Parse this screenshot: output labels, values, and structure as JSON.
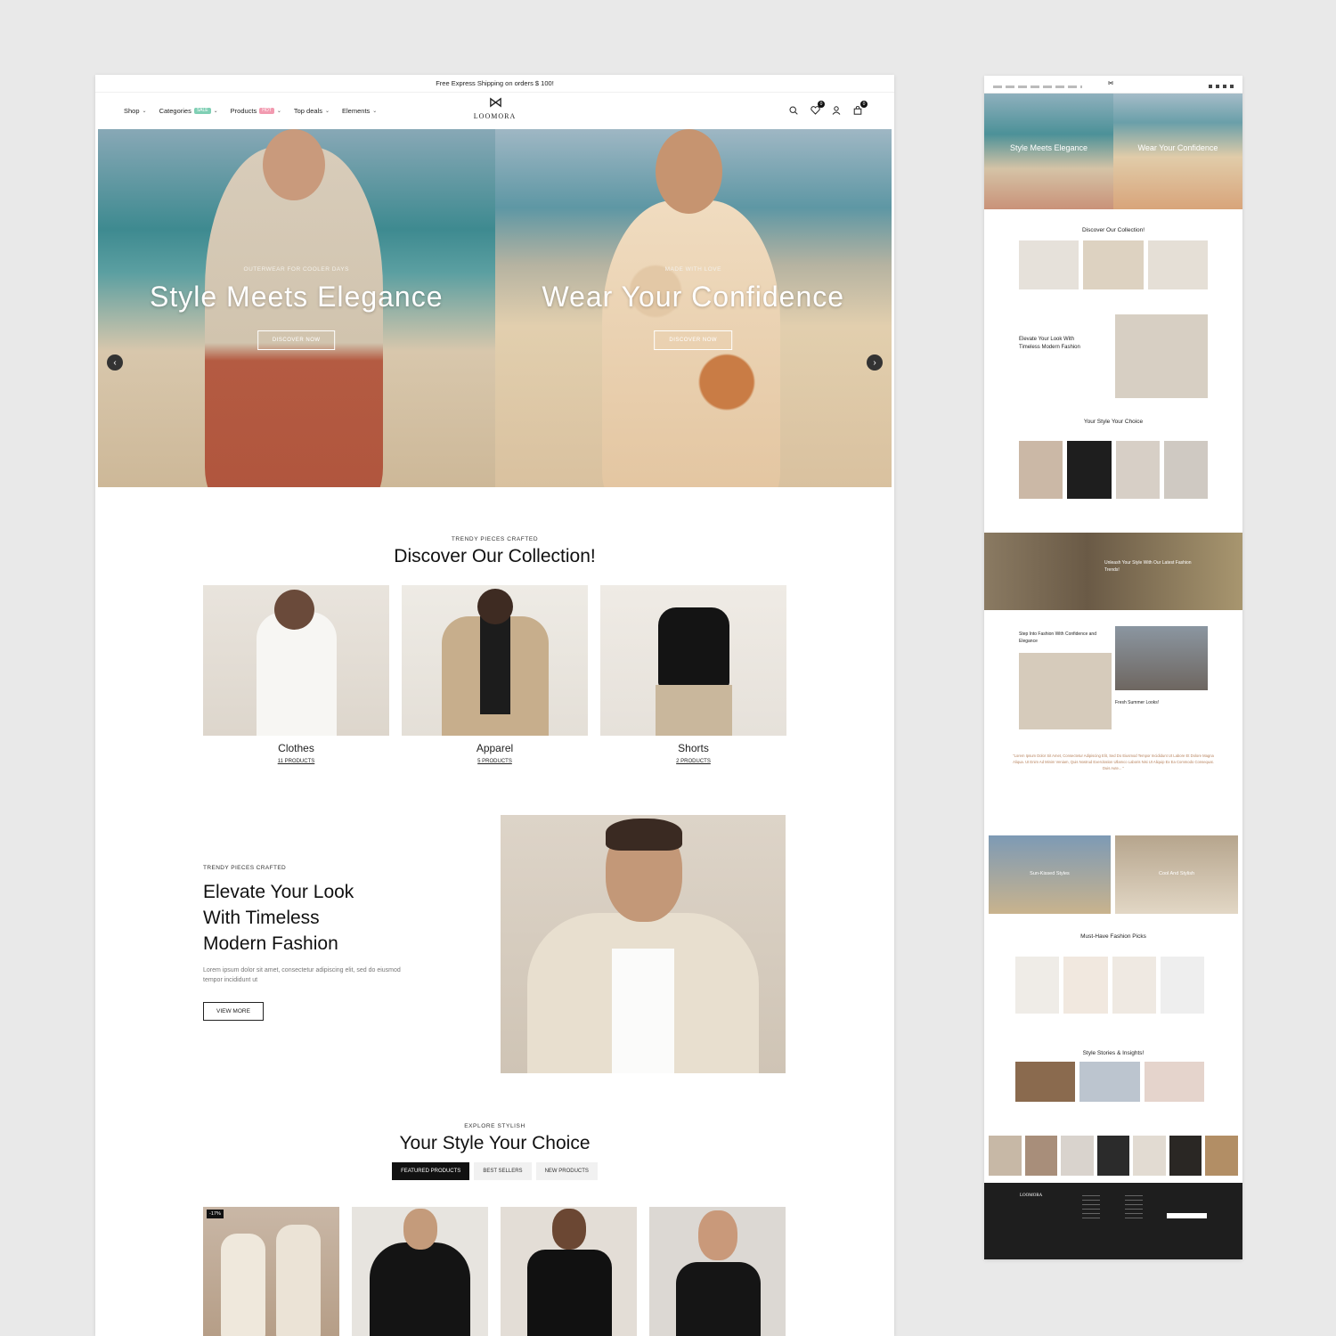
{
  "topbar": {
    "text": "Free Express Shipping on orders $ 100!"
  },
  "nav": {
    "items": [
      {
        "label": "Shop",
        "badge": ""
      },
      {
        "label": "Categories",
        "badge": "SALE",
        "badge_color": "#7fcfb4"
      },
      {
        "label": "Products",
        "badge": "HOT",
        "badge_color": "#f29ab0"
      },
      {
        "label": "Top deals",
        "badge": ""
      },
      {
        "label": "Elements",
        "badge": ""
      }
    ]
  },
  "brand": {
    "mark": "⋈",
    "name": "LOOMORA"
  },
  "header_icons": {
    "wishlist_count": "0",
    "cart_count": "0"
  },
  "hero": {
    "slides": [
      {
        "kicker": "OUTERWEAR FOR COOLER DAYS",
        "title": "Style Meets Elegance",
        "button": "DISCOVER NOW"
      },
      {
        "kicker": "MADE WITH LOVE",
        "title": "Wear Your Confidence",
        "button": "DISCOVER NOW"
      }
    ],
    "prev": "‹",
    "next": "›"
  },
  "collection": {
    "kicker": "TRENDY PIECES CRAFTED",
    "title": "Discover Our Collection!",
    "cards": [
      {
        "name": "Clothes",
        "count": "11 PRODUCTS"
      },
      {
        "name": "Apparel",
        "count": "5 PRODUCTS"
      },
      {
        "name": "Shorts",
        "count": "2 PRODUCTS"
      }
    ]
  },
  "promo": {
    "kicker": "TRENDY PIECES CRAFTED",
    "title_line1": "Elevate Your Look",
    "title_line2": "With Timeless",
    "title_line3": "Modern Fashion",
    "body": "Lorem ipsum dolor sit amet, consectetur adipiscing elit, sed do eiusmod tempor incididunt ut",
    "button": "VIEW MORE"
  },
  "products_section": {
    "kicker": "EXPLORE STYLISH",
    "title": "Your Style Your Choice",
    "tabs": [
      "FEATURED PRODUCTS",
      "BEST SELLERS",
      "NEW PRODUCTS"
    ],
    "sale_badge": "-17%"
  },
  "mini": {
    "hero_titles": [
      "Style Meets Elegance",
      "Wear Your Confidence"
    ],
    "collection_title": "Discover Our Collection!",
    "promo_title": "Elevate Your Look With Timeless Modern Fashion",
    "products_title": "Your Style Your Choice",
    "banner_title": "Unleash Your Style With Our Latest Fashion Trends!",
    "step_title": "Step Into Fashion With Confidence and Elegance",
    "summer_title": "Fresh Summer Looks!",
    "quote": "\"Lorem Ipsum Dolor Sit Amet, Consectetur Adipiscing Elit, Sed Do Eiusmod Tempor Incididunt Ut Labore Et Dolore Magna Aliqua. Ut Enim Ad Minim Veniam, Quis Nostrud Exercitation Ullamco Laboris Nisi Ut Aliquip Ex Ea Commodo Consequat. Duis Aute... \"",
    "tiles": [
      "Sun-Kissed Styles",
      "Cool And Stylish"
    ],
    "picks_title": "Must-Have Fashion Picks",
    "blog_title": "Style Stories & Insights!"
  },
  "colors": {
    "accent": "#111111",
    "quote": "#b8845f",
    "footer": "#1e1e1e"
  }
}
